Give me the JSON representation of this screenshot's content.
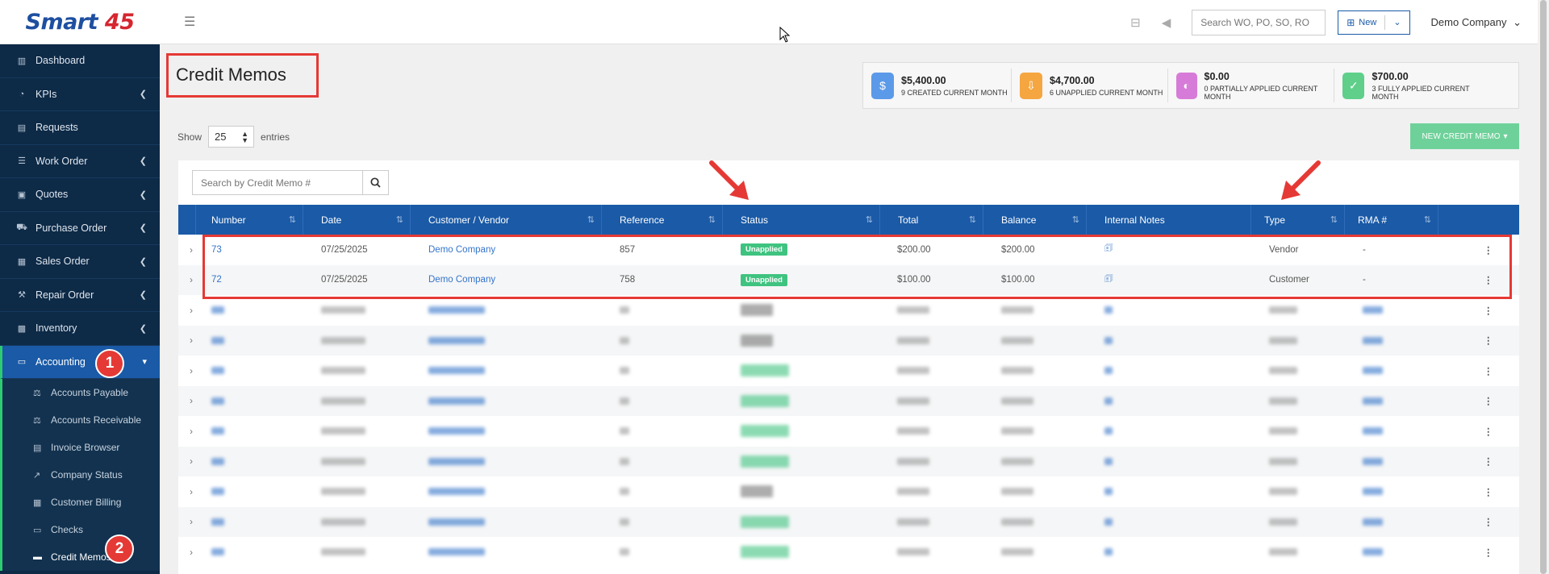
{
  "sidebar": {
    "logo": {
      "text": "Smart ",
      "accent": "45"
    },
    "items": [
      {
        "label": "Dashboard",
        "icon": "chart-icon",
        "chevron": false
      },
      {
        "label": "KPIs",
        "icon": "gauge-icon",
        "chevron": true
      },
      {
        "label": "Requests",
        "icon": "document-icon",
        "chevron": false
      },
      {
        "label": "Work Order",
        "icon": "list-icon",
        "chevron": true
      },
      {
        "label": "Quotes",
        "icon": "clipboard-icon",
        "chevron": true
      },
      {
        "label": "Purchase Order",
        "icon": "cart-icon",
        "chevron": true
      },
      {
        "label": "Sales Order",
        "icon": "tag-icon",
        "chevron": true
      },
      {
        "label": "Repair Order",
        "icon": "tools-icon",
        "chevron": true
      },
      {
        "label": "Inventory",
        "icon": "boxes-icon",
        "chevron": true
      }
    ],
    "accounting": {
      "label": "Accounting",
      "icon": "ledger-icon"
    },
    "sub_items": [
      {
        "label": "Accounts Payable",
        "icon": "scale-icon"
      },
      {
        "label": "Accounts Receivable",
        "icon": "scale-icon"
      },
      {
        "label": "Invoice Browser",
        "icon": "invoice-icon"
      },
      {
        "label": "Company Status",
        "icon": "trend-icon"
      },
      {
        "label": "Customer Billing",
        "icon": "grid-icon"
      },
      {
        "label": "Checks",
        "icon": "check-icon"
      },
      {
        "label": "Credit Memos",
        "icon": "memo-icon"
      }
    ],
    "step_badges": [
      "1",
      "2"
    ]
  },
  "topbar": {
    "search_placeholder": "Search WO, PO, SO, RO",
    "new_label": "New",
    "company": "Demo Company"
  },
  "page": {
    "title": "Credit Memos",
    "show_label": "Show",
    "entries_value": "25",
    "entries_label": "entries",
    "new_credit_memo_label": "NEW CREDIT MEMO",
    "table_search_placeholder": "Search by Credit Memo #"
  },
  "stats": [
    {
      "value": "$5,400.00",
      "label": "9 CREATED CURRENT MONTH",
      "color": "#5b9ae8"
    },
    {
      "value": "$4,700.00",
      "label": "6 UNAPPLIED CURRENT MONTH",
      "color": "#f5a640"
    },
    {
      "value": "$0.00",
      "label": "0 PARTIALLY APPLIED CURRENT MONTH",
      "color": "#d77bd8"
    },
    {
      "value": "$700.00",
      "label": "3 FULLY APPLIED CURRENT MONTH",
      "color": "#5fcf8a"
    }
  ],
  "table": {
    "columns": [
      "Number",
      "Date",
      "Customer / Vendor",
      "Reference",
      "Status",
      "Total",
      "Balance",
      "Internal Notes",
      "Type",
      "RMA #"
    ],
    "rows": [
      {
        "number": "73",
        "date": "07/25/2025",
        "party": "Demo Company",
        "reference": "857",
        "status": "Unapplied",
        "total": "$200.00",
        "balance": "$200.00",
        "type": "Vendor",
        "rma": "-"
      },
      {
        "number": "72",
        "date": "07/25/2025",
        "party": "Demo Company",
        "reference": "758",
        "status": "Unapplied",
        "total": "$100.00",
        "balance": "$100.00",
        "type": "Customer",
        "rma": "-"
      }
    ],
    "blurred_row_count": 9
  },
  "colors": {
    "brand_blue": "#1a5aa7",
    "sidebar": "#0d2a47",
    "success": "#3fc380",
    "annotation_red": "#e53935"
  }
}
